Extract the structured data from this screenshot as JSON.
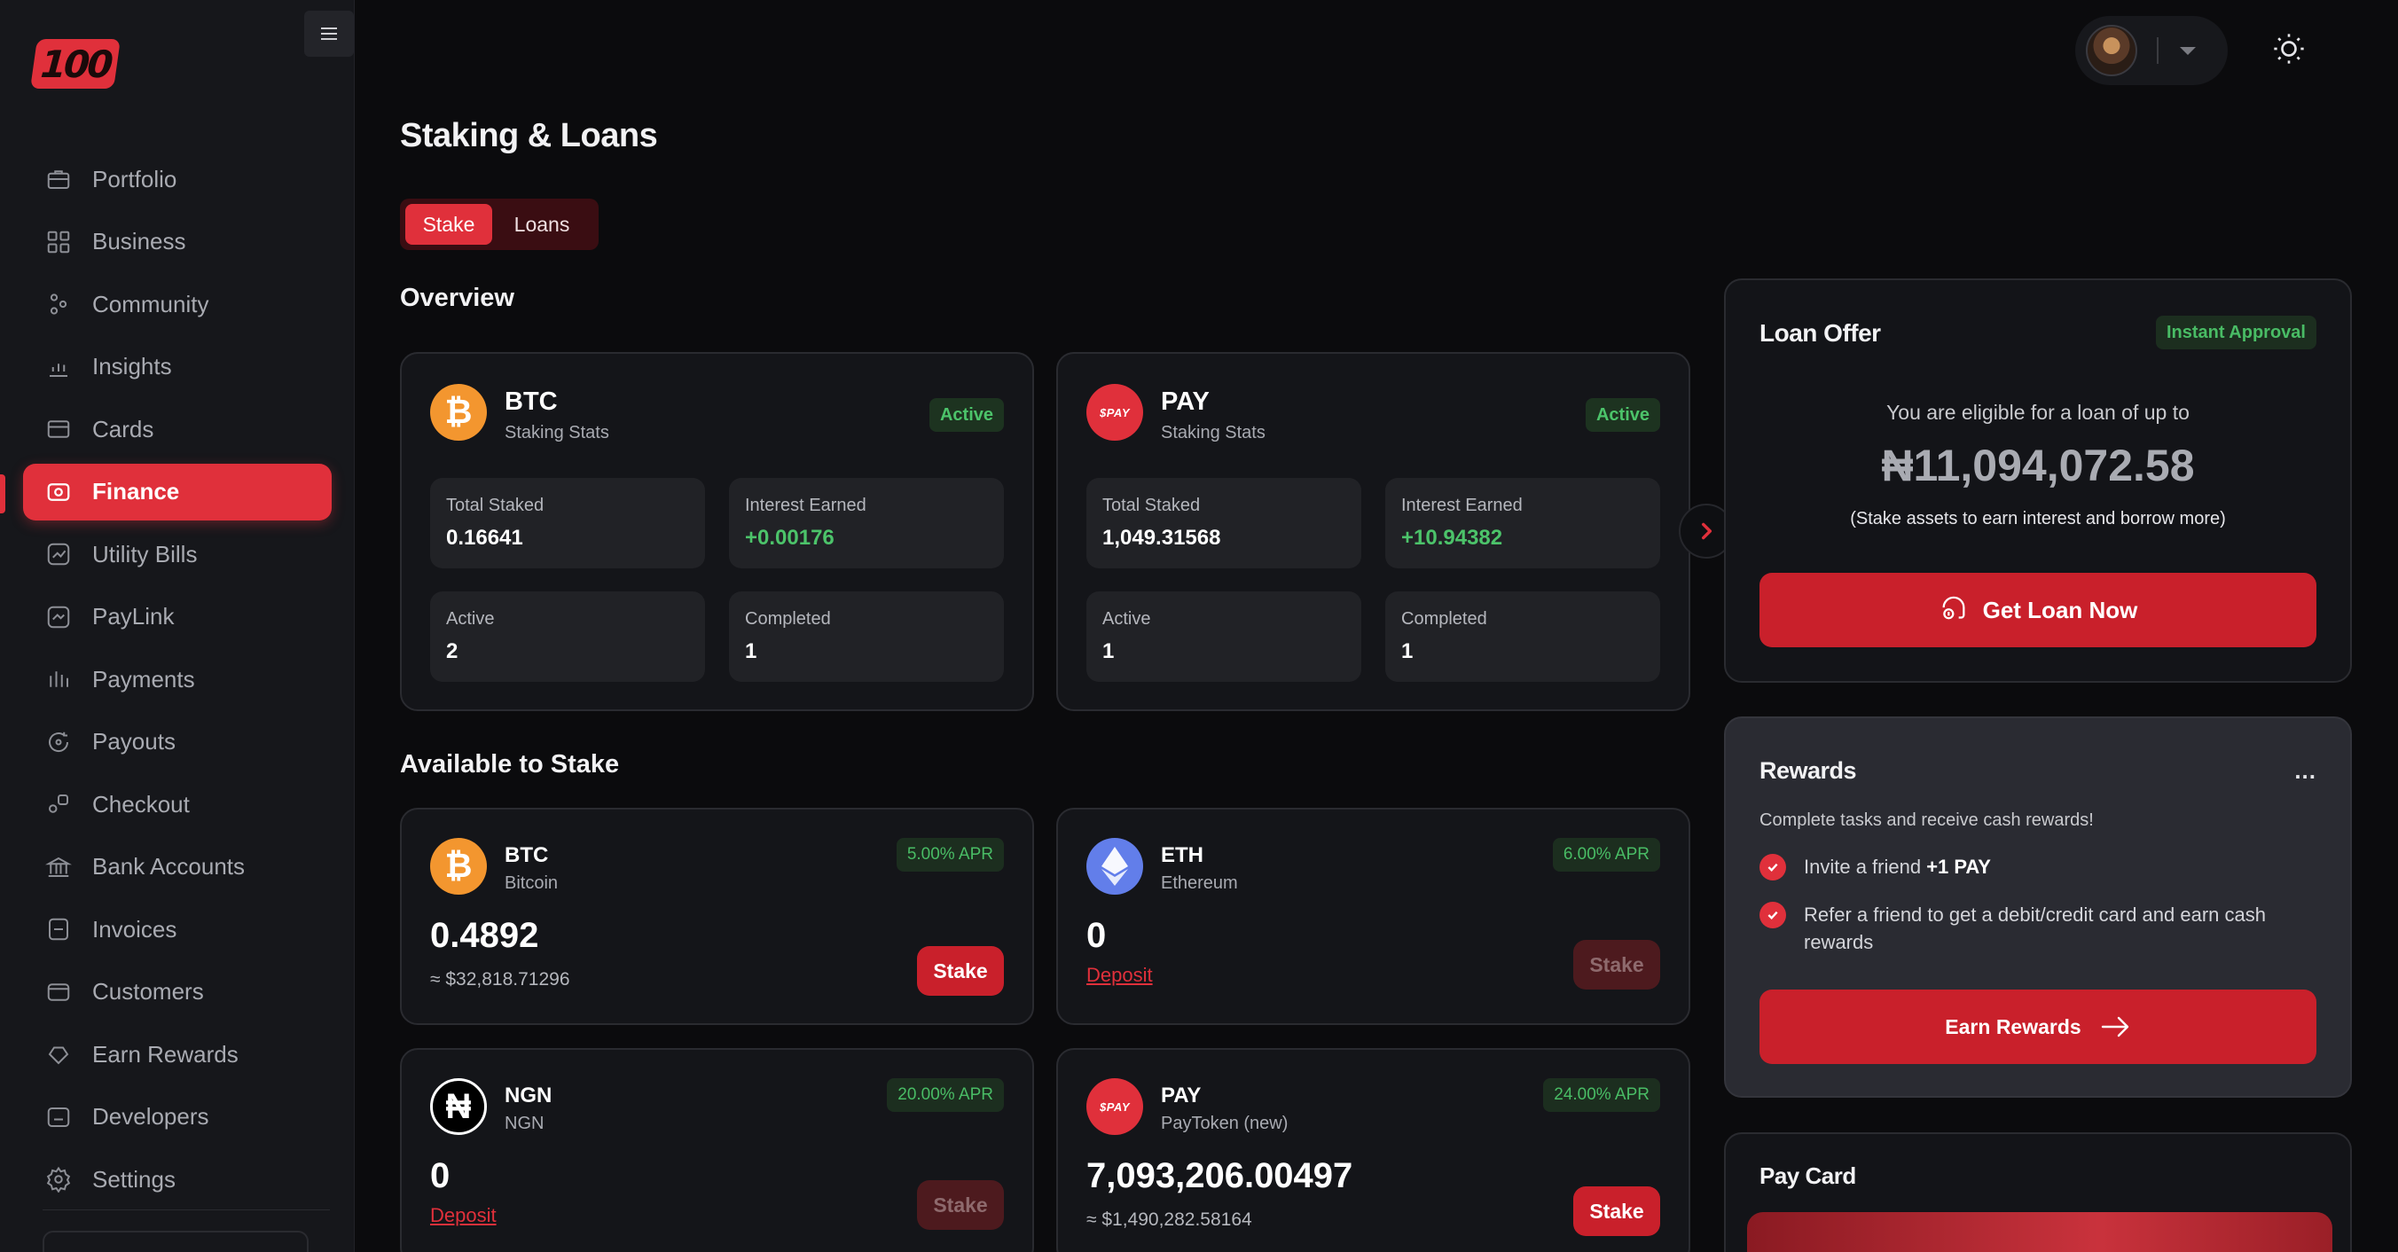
{
  "app": {
    "logo_text": "100"
  },
  "sidebar": {
    "items": [
      {
        "label": "Portfolio",
        "icon": "briefcase-icon",
        "active": false
      },
      {
        "label": "Business",
        "icon": "grid-icon",
        "active": false
      },
      {
        "label": "Community",
        "icon": "community-icon",
        "active": false
      },
      {
        "label": "Insights",
        "icon": "bar-chart-icon",
        "active": false
      },
      {
        "label": "Cards",
        "icon": "card-icon",
        "active": false
      },
      {
        "label": "Finance",
        "icon": "finance-icon",
        "active": true
      },
      {
        "label": "Utility Bills",
        "icon": "utility-icon",
        "active": false
      },
      {
        "label": "PayLink",
        "icon": "link-icon",
        "active": false
      },
      {
        "label": "Payments",
        "icon": "payments-icon",
        "active": false
      },
      {
        "label": "Payouts",
        "icon": "payouts-icon",
        "active": false
      },
      {
        "label": "Checkout",
        "icon": "checkout-icon",
        "active": false
      },
      {
        "label": "Bank Accounts",
        "icon": "bank-icon",
        "active": false
      },
      {
        "label": "Invoices",
        "icon": "invoice-icon",
        "active": false
      },
      {
        "label": "Customers",
        "icon": "customers-icon",
        "active": false
      },
      {
        "label": "Earn Rewards",
        "icon": "rewards-icon",
        "active": false
      },
      {
        "label": "Developers",
        "icon": "code-icon",
        "active": false
      },
      {
        "label": "Settings",
        "icon": "gear-icon",
        "active": false
      }
    ]
  },
  "page": {
    "title": "Staking & Loans"
  },
  "tabs": {
    "stake": "Stake",
    "loans": "Loans"
  },
  "overview": {
    "title": "Overview",
    "cards": [
      {
        "symbol": "BTC",
        "subtitle": "Staking Stats",
        "status": "Active",
        "total_staked_label": "Total Staked",
        "total_staked": "0.16641",
        "interest_label": "Interest Earned",
        "interest": "+0.00176",
        "active_label": "Active",
        "active": "2",
        "completed_label": "Completed",
        "completed": "1"
      },
      {
        "symbol": "PAY",
        "subtitle": "Staking Stats",
        "status": "Active",
        "total_staked_label": "Total Staked",
        "total_staked": "1,049.31568",
        "interest_label": "Interest Earned",
        "interest": "+10.94382",
        "active_label": "Active",
        "active": "1",
        "completed_label": "Completed",
        "completed": "1"
      }
    ]
  },
  "available": {
    "title": "Available to Stake",
    "stake_label": "Stake",
    "deposit_label": "Deposit",
    "assets": [
      {
        "symbol": "BTC",
        "name": "Bitcoin",
        "apr": "5.00% APR",
        "balance": "0.4892",
        "approx": "≈ $32,818.71296"
      },
      {
        "symbol": "ETH",
        "name": "Ethereum",
        "apr": "6.00% APR",
        "balance": "0"
      },
      {
        "symbol": "NGN",
        "name": "NGN",
        "apr": "20.00% APR",
        "balance": "0"
      },
      {
        "symbol": "PAY",
        "name": "PayToken (new)",
        "apr": "24.00% APR",
        "balance": "7,093,206.00497",
        "approx": "≈ $1,490,282.58164"
      }
    ]
  },
  "coin_marks": {
    "btc": "₿",
    "pay": "$PAY",
    "ngn": "₦"
  },
  "loan_offer": {
    "title": "Loan Offer",
    "badge": "Instant Approval",
    "eligible_text": "You are eligible for a loan of up to",
    "amount": "₦11,094,072.58",
    "note": "(Stake assets to earn interest and borrow more)",
    "button": "Get Loan Now"
  },
  "rewards": {
    "title": "Rewards",
    "more": "...",
    "subtitle": "Complete tasks and receive cash rewards!",
    "task1_text": "Invite a friend ",
    "task1_bold": "+1 PAY",
    "task2_text": "Refer a friend to get a debit/credit card and earn cash rewards",
    "button": "Earn Rewards"
  },
  "pay_card": {
    "title": "Pay Card"
  },
  "colors": {
    "accent": "#e0303b",
    "button": "#c9202b",
    "success": "#4cc36a",
    "background": "#0b0b0d"
  }
}
